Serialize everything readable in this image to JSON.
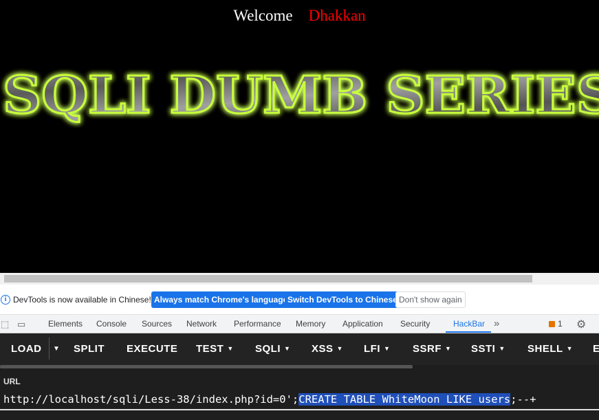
{
  "page": {
    "welcome_label": "Welcome",
    "welcome_name": "Dhakkan",
    "banner_text": "SQLI DUMB SERIES",
    "colors": {
      "background": "#000000",
      "welcome": "#ffffff",
      "name": "#ff0000",
      "banner_glow": "#a8ff1a"
    }
  },
  "infobar": {
    "icon": "info-icon",
    "message": "DevTools is now available in Chinese!",
    "btn_match": "Always match Chrome's language",
    "btn_switch": "Switch DevTools to Chinese",
    "btn_dismiss": "Don't show again"
  },
  "devtools": {
    "tabs": [
      "Elements",
      "Console",
      "Sources",
      "Network",
      "Performance",
      "Memory",
      "Application",
      "Security",
      "HackBar"
    ],
    "active_tab": "HackBar",
    "more_icon": "chevron-double-right-icon",
    "issues_count": "1"
  },
  "hackbar": {
    "buttons": {
      "load": "LOAD",
      "split": "SPLIT",
      "execute": "EXECUTE",
      "test": "TEST",
      "sqli": "SQLI",
      "xss": "XSS",
      "lfi": "LFI",
      "ssrf": "SSRF",
      "ssti": "SSTI",
      "shell": "SHELL",
      "encode": "E"
    },
    "url_label": "URL",
    "url_prefix": "http://localhost/sqli/Less-38/index.php?id=0';",
    "url_selected": "CREATE TABLE WhiteMoon LIKE users",
    "url_suffix": ";--+"
  }
}
